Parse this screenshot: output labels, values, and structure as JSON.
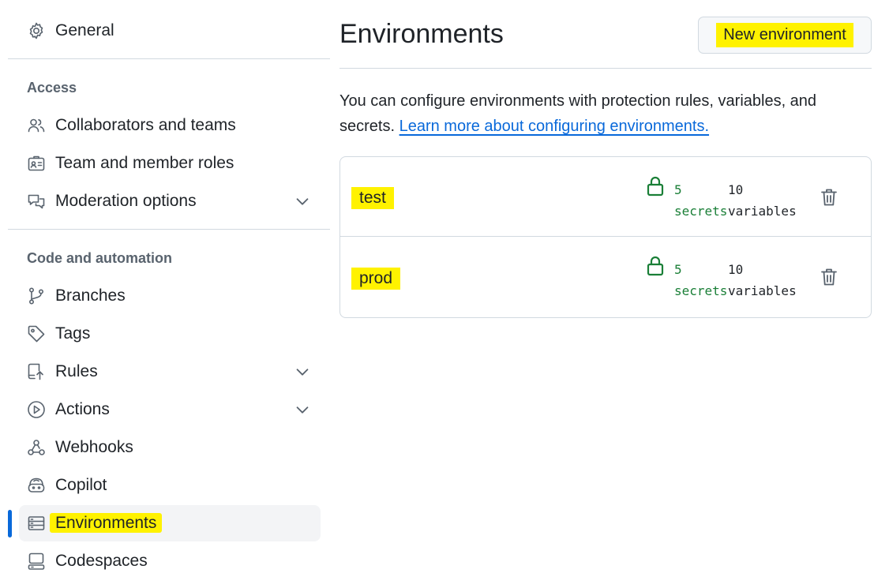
{
  "sidebar": {
    "top_item": {
      "label": "General",
      "icon": "gear-icon"
    },
    "groups": [
      {
        "heading": "Access",
        "items": [
          {
            "label": "Collaborators and teams",
            "icon": "people-icon"
          },
          {
            "label": "Team and member roles",
            "icon": "id-badge-icon"
          },
          {
            "label": "Moderation options",
            "icon": "comment-discussion-icon",
            "expandable": true
          }
        ]
      },
      {
        "heading": "Code and automation",
        "items": [
          {
            "label": "Branches",
            "icon": "git-branch-icon"
          },
          {
            "label": "Tags",
            "icon": "tag-icon"
          },
          {
            "label": "Rules",
            "icon": "repo-push-icon",
            "expandable": true
          },
          {
            "label": "Actions",
            "icon": "play-icon",
            "expandable": true
          },
          {
            "label": "Webhooks",
            "icon": "webhook-icon"
          },
          {
            "label": "Copilot",
            "icon": "copilot-icon"
          },
          {
            "label": "Environments",
            "icon": "server-icon",
            "active": true
          },
          {
            "label": "Codespaces",
            "icon": "codespaces-icon"
          }
        ]
      }
    ]
  },
  "main": {
    "title": "Environments",
    "new_button_label": "New environment",
    "description": "You can configure environments with protection rules, variables, and secrets.",
    "learn_more_link": "Learn more about configuring environments.",
    "environments": [
      {
        "name": "test",
        "secrets_count": "5",
        "secrets_label": "secrets",
        "variables_count": "10",
        "variables_label": "variables"
      },
      {
        "name": "prod",
        "secrets_count": "5",
        "secrets_label": "secrets",
        "variables_count": "10",
        "variables_label": "variables"
      }
    ]
  },
  "colors": {
    "accent": "#0969da",
    "highlight": "#fff200",
    "success": "#1a7f37",
    "muted": "#59636e",
    "border": "#d1d9e0"
  }
}
